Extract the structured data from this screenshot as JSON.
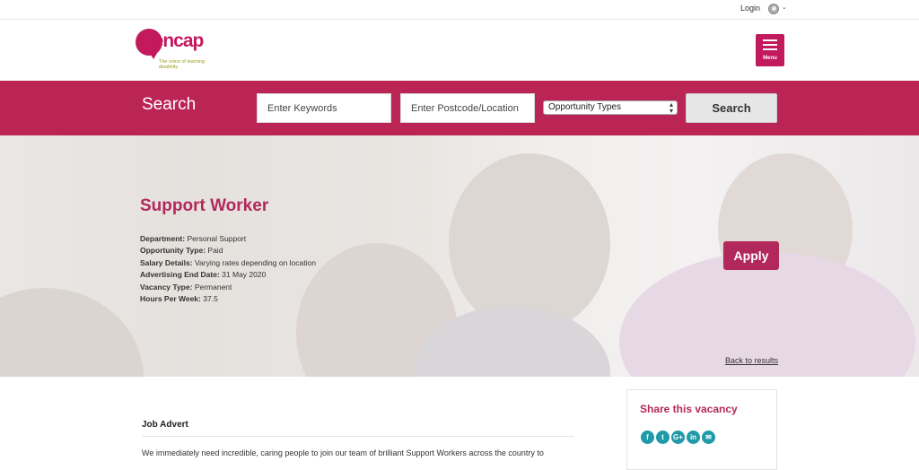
{
  "topbar": {
    "login_label": "Login",
    "avatar_icon": "user-avatar-icon",
    "caret": "⌄"
  },
  "header": {
    "logo_text": "mencap",
    "logo_tagline": "The voice of learning disability",
    "menu_label": "Menu",
    "brand_color": "#c3195d"
  },
  "search": {
    "title": "Search",
    "keywords_placeholder": "Enter Keywords",
    "location_placeholder": "Enter Postcode/Location",
    "type_selected": "Opportunity Types",
    "button_label": "Search"
  },
  "job": {
    "title": "Support Worker",
    "details": [
      {
        "label": "Department:",
        "value": "Personal Support"
      },
      {
        "label": "Opportunity Type:",
        "value": "Paid"
      },
      {
        "label": "Salary Details:",
        "value": "Varying rates depending on location"
      },
      {
        "label": "Advertising End Date:",
        "value": "31 May 2020"
      },
      {
        "label": "Vacancy Type:",
        "value": "Permanent"
      },
      {
        "label": "Hours Per Week:",
        "value": "37.5"
      }
    ],
    "apply_label": "Apply",
    "back_label": "Back to results"
  },
  "advert": {
    "heading": "Job Advert",
    "text": "We immediately need incredible, caring people to join our team of brilliant Support Workers across the country to"
  },
  "share": {
    "title": "Share this vacancy",
    "icons": [
      {
        "name": "facebook-icon",
        "glyph": "f"
      },
      {
        "name": "twitter-icon",
        "glyph": "t"
      },
      {
        "name": "google-plus-icon",
        "glyph": "G+"
      },
      {
        "name": "linkedin-icon",
        "glyph": "in"
      },
      {
        "name": "email-icon",
        "glyph": "✉"
      }
    ],
    "icon_color": "#1f9aa8"
  }
}
